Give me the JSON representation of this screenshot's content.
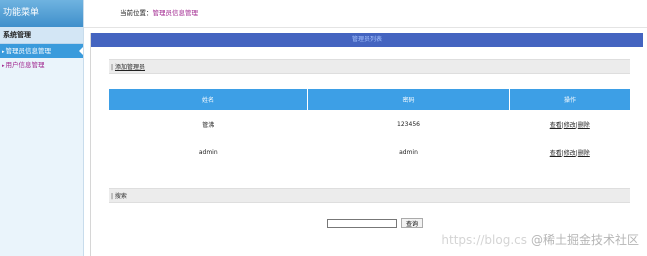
{
  "sidebar": {
    "title": "功能菜单",
    "group": "系统管理",
    "items": [
      {
        "label": "管理员信息管理"
      },
      {
        "label": "用户信息管理"
      }
    ]
  },
  "topbar": {
    "location_label": "当前位置：",
    "location_value": "管理员信息管理"
  },
  "main": {
    "panel_title": "管理员列表",
    "add_section_prefix": "|",
    "add_link": "添加管理员",
    "table": {
      "headers": [
        "姓名",
        "密码",
        "操作"
      ],
      "rows": [
        {
          "name": "管沸",
          "password": "123456"
        },
        {
          "name": "admin",
          "password": "admin"
        }
      ],
      "actions": [
        "查看",
        "修改",
        "删除"
      ],
      "action_sep": "|"
    },
    "search_section_label": "| 搜索",
    "search_input_value": "",
    "search_button": "查询"
  },
  "watermark": {
    "url": "https://blog.cs",
    "brand": "@稀土掘金技术社区"
  }
}
